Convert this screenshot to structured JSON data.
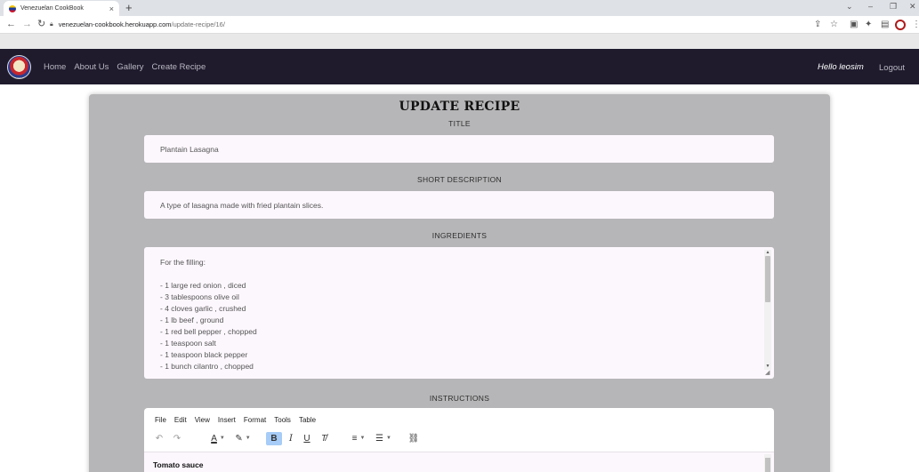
{
  "browser": {
    "tab_title": "Venezuelan CookBook",
    "tab_close": "×",
    "new_tab": "+",
    "url_host": "venezuelan-cookbook.herokuapp.com",
    "url_path": "/update-recipe/16/"
  },
  "icons": {
    "favicon": "venezuela-flag-icon",
    "back": "arrow-left-icon",
    "forward": "arrow-right-icon",
    "reload": "reload-icon",
    "lock": "lock-icon",
    "share": "share-icon",
    "star": "star-icon",
    "extensions": "puzzle-icon",
    "sidebar": "sidebar-icon",
    "profile": "profile-avatar-icon",
    "menu": "kebab-menu-icon"
  },
  "navbar": {
    "links": [
      "Home",
      "About Us",
      "Gallery",
      "Create Recipe"
    ],
    "greeting": "Hello leosim",
    "logout": "Logout"
  },
  "form": {
    "heading": "UPDATE RECIPE",
    "title_label": "TITLE",
    "title_value": "Plantain Lasagna",
    "short_desc_label": "SHORT DESCRIPTION",
    "short_desc_value": "A type of lasagna made with fried plantain slices.",
    "ingredients_label": "INGREDIENTS",
    "ingredients_lines": [
      "For the filling:",
      "",
      "- 1 large red onion , diced",
      "- 3 tablespoons olive oil",
      "- 4 cloves garlic , crushed",
      "- 1 lb beef , ground",
      "- 1 red bell pepper , chopped",
      "- 1 teaspoon salt",
      "- 1 teaspoon black pepper",
      "- 1 bunch cilantro , chopped"
    ],
    "instructions_label": "INSTRUCTIONS"
  },
  "editor": {
    "menu": [
      "File",
      "Edit",
      "View",
      "Insert",
      "Format",
      "Tools",
      "Table"
    ],
    "content_first_line": "Tomato sauce",
    "active_tool": "bold"
  },
  "colors": {
    "navbar_bg": "#1f1b2d",
    "card_bg": "#b6b6b8",
    "field_bg": "#fcf7fd",
    "active_tool_bg": "#a6ccf7"
  }
}
